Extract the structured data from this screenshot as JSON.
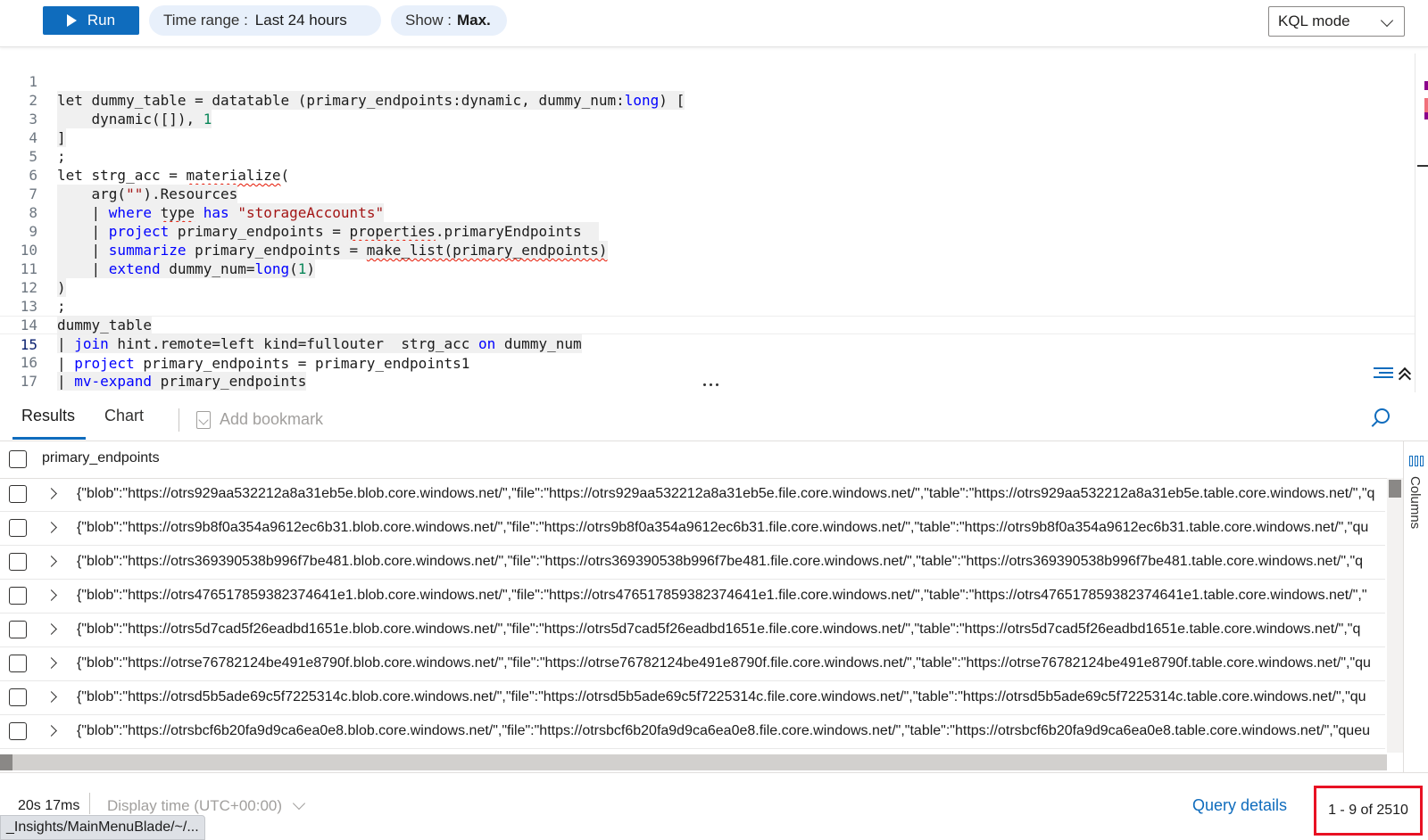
{
  "toolbar": {
    "run_label": "Run",
    "time_range_key": "Time range :",
    "time_range_value": "Last 24 hours",
    "show_key": "Show :",
    "show_value": "Max.",
    "mode_label": "KQL mode"
  },
  "editor": {
    "line_numbers": [
      "1",
      "2",
      "3",
      "4",
      "5",
      "6",
      "7",
      "8",
      "9",
      "10",
      "11",
      "12",
      "13",
      "14",
      "15",
      "16",
      "17"
    ],
    "current_line": "15",
    "lines_text": [
      "let dummy_table = datatable (primary_endpoints:dynamic, dummy_num:long) [",
      "    dynamic([]), 1",
      "]",
      ";",
      "let strg_acc = materialize(",
      "    arg(\"\").Resources",
      "    | where type has \"storageAccounts\"",
      "    | project primary_endpoints = properties.primaryEndpoints",
      "    | summarize primary_endpoints = make_list(primary_endpoints)",
      "    | extend dummy_num=long(1)",
      ")",
      ";",
      "dummy_table",
      "| join hint.remote=left kind=fullouter  strg_acc on dummy_num",
      "| project primary_endpoints = primary_endpoints1",
      "| mv-expand primary_endpoints",
      ""
    ]
  },
  "results": {
    "tabs": [
      "Results",
      "Chart"
    ],
    "active_tab": "Results",
    "add_bookmark_label": "Add bookmark",
    "column_header": "primary_endpoints",
    "rows": [
      "{\"blob\":\"https://otrs929aa532212a8a31eb5e.blob.core.windows.net/\",\"file\":\"https://otrs929aa532212a8a31eb5e.file.core.windows.net/\",\"table\":\"https://otrs929aa532212a8a31eb5e.table.core.windows.net/\",\"q",
      "{\"blob\":\"https://otrs9b8f0a354a9612ec6b31.blob.core.windows.net/\",\"file\":\"https://otrs9b8f0a354a9612ec6b31.file.core.windows.net/\",\"table\":\"https://otrs9b8f0a354a9612ec6b31.table.core.windows.net/\",\"qu",
      "{\"blob\":\"https://otrs369390538b996f7be481.blob.core.windows.net/\",\"file\":\"https://otrs369390538b996f7be481.file.core.windows.net/\",\"table\":\"https://otrs369390538b996f7be481.table.core.windows.net/\",\"q",
      "{\"blob\":\"https://otrs476517859382374641e1.blob.core.windows.net/\",\"file\":\"https://otrs476517859382374641e1.file.core.windows.net/\",\"table\":\"https://otrs476517859382374641e1.table.core.windows.net/\",\"",
      "{\"blob\":\"https://otrs5d7cad5f26eadbd1651e.blob.core.windows.net/\",\"file\":\"https://otrs5d7cad5f26eadbd1651e.file.core.windows.net/\",\"table\":\"https://otrs5d7cad5f26eadbd1651e.table.core.windows.net/\",\"q",
      "{\"blob\":\"https://otrse76782124be491e8790f.blob.core.windows.net/\",\"file\":\"https://otrse76782124be491e8790f.file.core.windows.net/\",\"table\":\"https://otrse76782124be491e8790f.table.core.windows.net/\",\"qu",
      "{\"blob\":\"https://otrsd5b5ade69c5f7225314c.blob.core.windows.net/\",\"file\":\"https://otrsd5b5ade69c5f7225314c.file.core.windows.net/\",\"table\":\"https://otrsd5b5ade69c5f7225314c.table.core.windows.net/\",\"qu",
      "{\"blob\":\"https://otrsbcf6b20fa9d9ca6ea0e8.blob.core.windows.net/\",\"file\":\"https://otrsbcf6b20fa9d9ca6ea0e8.file.core.windows.net/\",\"table\":\"https://otrsbcf6b20fa9d9ca6ea0e8.table.core.windows.net/\",\"queu"
    ],
    "columns_panel_label": "Columns"
  },
  "footer": {
    "elapsed": "20s 17ms",
    "display_time": "Display time (UTC+00:00)",
    "query_details": "Query details",
    "row_count": "1 - 9 of 2510"
  },
  "status_bar_url": "_Insights/MainMenuBlade/~/...",
  "colors": {
    "accent": "#0f6cbd",
    "keyword": "#0000ff",
    "string": "#a31515",
    "number": "#098658",
    "highlight_box": "#e81123"
  },
  "icons": [
    "play-icon",
    "chevron-down-icon",
    "bookmark-icon",
    "search-icon",
    "expand-chevron-icon",
    "columns-icon",
    "word-wrap-icon",
    "collapse-up-icon"
  ]
}
